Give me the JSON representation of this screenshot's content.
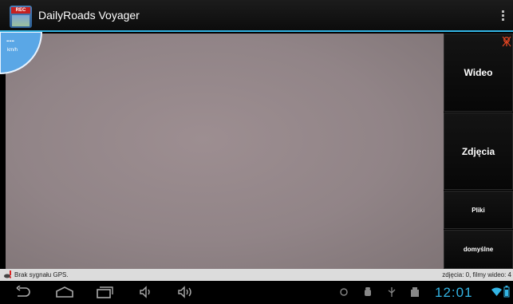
{
  "app": {
    "title": "DailyRoads Voyager",
    "icon_badge": "REC"
  },
  "speedometer": {
    "value": "---",
    "unit": "km/h"
  },
  "sidebar": {
    "video_label": "Wideo",
    "photos_label": "Zdjęcia",
    "files_label": "Pliki",
    "defaults_label": "domyślne"
  },
  "status": {
    "gps_text": "Brak sygnału GPS.",
    "counts_text": "zdjęcia: 0, filmy wideo: 4"
  },
  "system": {
    "clock": "12:01"
  },
  "colors": {
    "accent": "#33b5e5",
    "status_bg": "#dcdcdc",
    "camera_tint": "#928587"
  }
}
